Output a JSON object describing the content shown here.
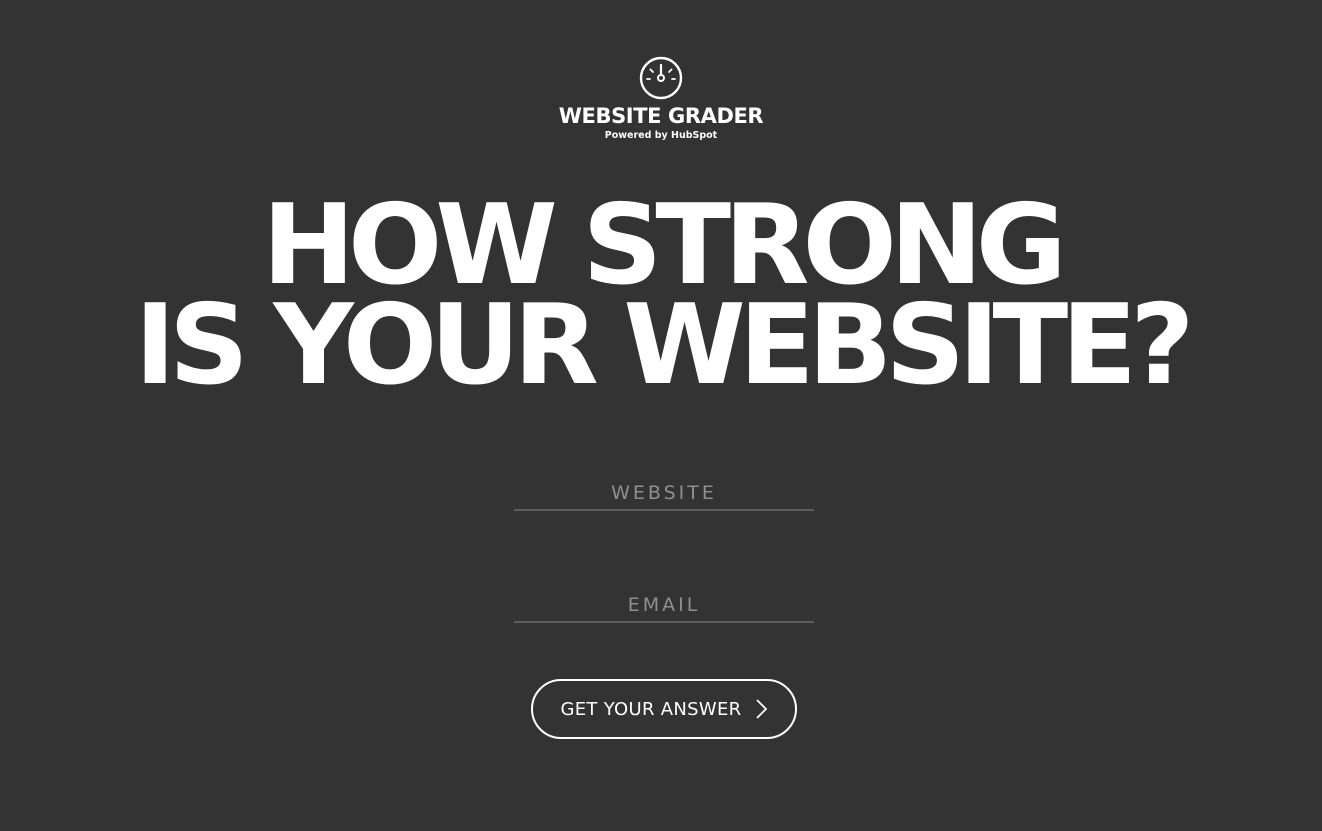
{
  "logo": {
    "icon": "speedometer-icon",
    "title": "WEBSITE GRADER",
    "subtitle": "Powered by HubSpot"
  },
  "headline": {
    "line1": "HOW STRONG",
    "line2": "IS YOUR WEBSITE?"
  },
  "form": {
    "website": {
      "placeholder": "WEBSITE",
      "value": ""
    },
    "email": {
      "placeholder": "EMAIL",
      "value": ""
    },
    "submit": {
      "label": "GET YOUR ANSWER",
      "icon": "chevron-right-icon"
    }
  },
  "colors": {
    "background": "#333333",
    "text": "#ffffff",
    "placeholder": "#8f8f8f",
    "underline": "#5c5c5c"
  }
}
